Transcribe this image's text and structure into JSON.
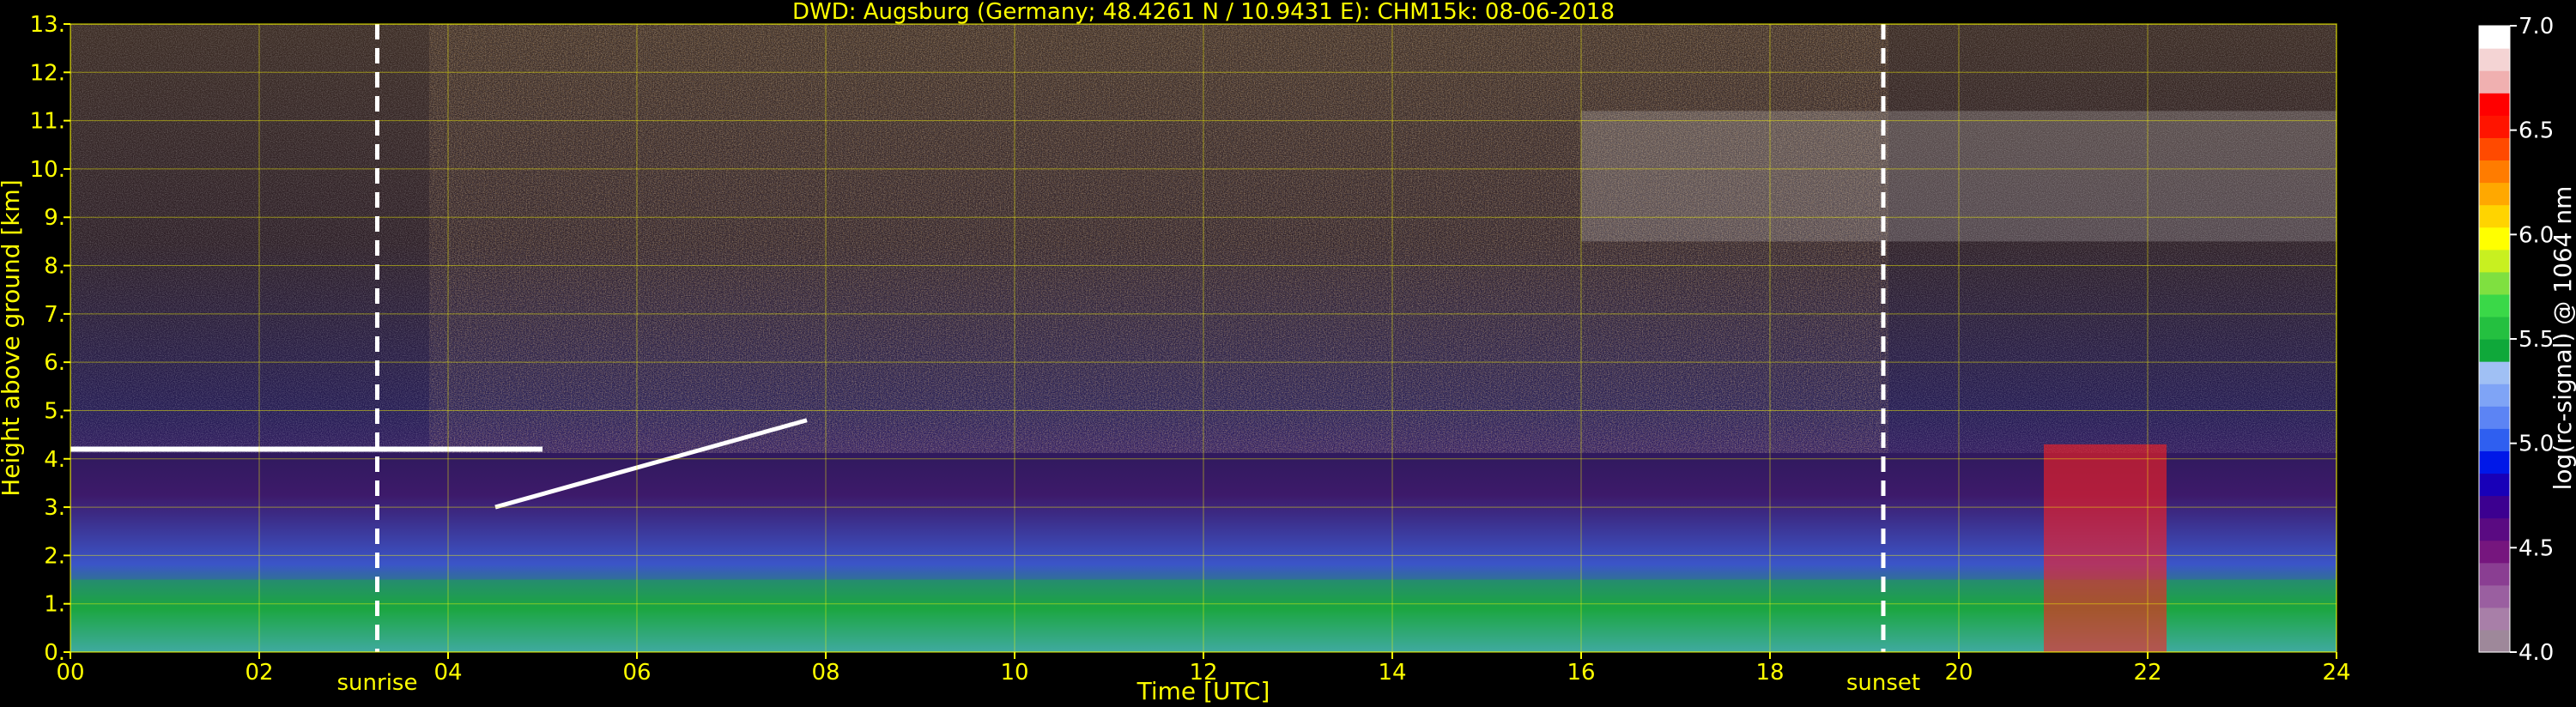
{
  "chart_data": {
    "type": "heatmap",
    "title": "DWD: Augsburg (Germany; 48.4261 N / 10.9431 E):    CHM15k: 08-06-2018",
    "xlabel": "Time [UTC]",
    "ylabel": "Height above ground [km]",
    "xlim": [
      0,
      24
    ],
    "ylim": [
      0,
      13
    ],
    "x_ticks": [
      "00",
      "02",
      "04",
      "06",
      "08",
      "10",
      "12",
      "14",
      "16",
      "18",
      "20",
      "22",
      "24"
    ],
    "y_ticks": [
      "0.",
      "1.",
      "2.",
      "3.",
      "4.",
      "5.",
      "6.",
      "7.",
      "8.",
      "9.",
      "10.",
      "11.",
      "12.",
      "13."
    ],
    "grid": true,
    "colorbar": {
      "label": "log(rc-signal) @ 1064 nm",
      "range": [
        4.0,
        7.0
      ],
      "ticks": [
        "4.0",
        "4.5",
        "5.0",
        "5.5",
        "6.0",
        "6.5",
        "7.0"
      ],
      "colors": [
        "#9e889a",
        "#a87fa8",
        "#9a5fa0",
        "#8a3e92",
        "#76167e",
        "#5a0a82",
        "#3c0090",
        "#1800b8",
        "#0018e8",
        "#2f5ff0",
        "#5c84f4",
        "#7fa4f6",
        "#a0c0f4",
        "#0fa83a",
        "#24c040",
        "#3ad848",
        "#7fe040",
        "#c8f020",
        "#ffff00",
        "#ffd400",
        "#ffa800",
        "#ff7c00",
        "#ff4a00",
        "#ff1400",
        "#ff0000",
        "#f0b0b0",
        "#f4d4d4",
        "#ffffff"
      ]
    },
    "events": [
      {
        "label": "sunrise",
        "x": 3.25
      },
      {
        "label": "sunset",
        "x": 19.2
      }
    ],
    "features": [
      {
        "type": "aerosol_layer_top",
        "x_start": 0.0,
        "x_end": 5.0,
        "y": 4.2
      },
      {
        "type": "elevated_layer",
        "x_start": 4.5,
        "x_end": 7.8,
        "y_start": 3.0,
        "y_end": 4.8
      },
      {
        "type": "boundary_layer",
        "x_start": 0.0,
        "x_end": 24.0,
        "y": 1.5
      },
      {
        "type": "cirrus",
        "x_start": 16.0,
        "x_end": 24.0,
        "y_start": 8.5,
        "y_end": 11.2
      },
      {
        "type": "convective_cloud",
        "x_start": 20.9,
        "x_end": 22.2,
        "y_start": 0.0,
        "y_end": 4.3
      }
    ]
  }
}
